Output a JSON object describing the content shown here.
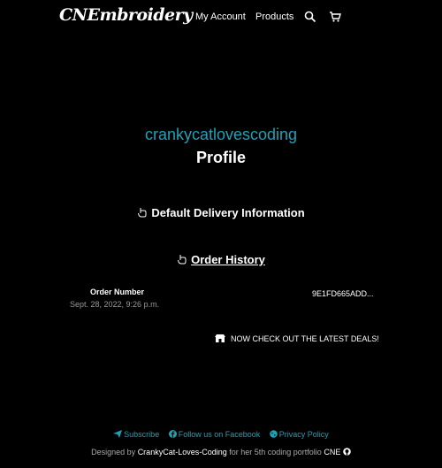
{
  "nav": {
    "brand": "CNEmbroidery",
    "my_account": "My Account",
    "products": "Products",
    "search_icon": "search-icon",
    "cart_icon": "cart-icon"
  },
  "profile": {
    "username": "crankycatlovescoding",
    "title": "Profile"
  },
  "sections": {
    "delivery": "Default Delivery Information",
    "history": "Order History"
  },
  "order": {
    "label": "Order Number",
    "date": "Sept. 28, 2022, 9:26 p.m.",
    "number": "9E1FD665ADD..."
  },
  "deals": "NOW CHECK OUT THE LATEST DEALS!",
  "footer": {
    "subscribe": "Subscribe",
    "facebook": "Follow us on Facebook",
    "privacy": "Privacy Policy",
    "designed_by": "Designed by",
    "author": "CrankyCat-Loves-Coding",
    "for_text": "for her 5th coding portfolio",
    "cne": "CNE"
  },
  "colors": {
    "accent": "#22a0b5",
    "background": "#000000",
    "text": "#ffffff"
  }
}
